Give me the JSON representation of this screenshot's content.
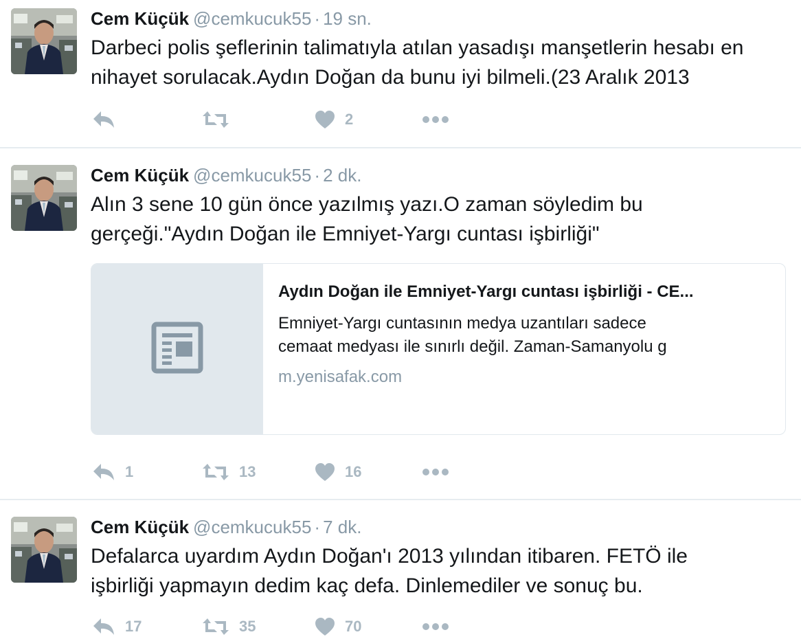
{
  "tweets": [
    {
      "name": "Cem Küçük",
      "handle": "@cemkucuk55",
      "separator": "·",
      "time": "19 sn.",
      "line1": "Darbeci polis şeflerinin talimatıyla atılan yasadışı manşetlerin hesabı en",
      "line2": "nihayet sorulacak.Aydın Doğan da bunu iyi bilmeli.(23 Aralık 2013",
      "reply_count": "",
      "retweet_count": "",
      "like_count": "2"
    },
    {
      "name": "Cem Küçük",
      "handle": "@cemkucuk55",
      "separator": "·",
      "time": "2 dk.",
      "line1": "Alın 3 sene 10 gün önce yazılmış yazı.O zaman söyledim bu",
      "line2": "gerçeği.\"Aydın Doğan ile Emniyet-Yargı cuntası işbirliği\"",
      "card": {
        "title": "Aydın Doğan ile Emniyet-Yargı cuntası işbirliği - CE...",
        "desc_line1": "Emniyet-Yargı cuntasının medya uzantıları sadece",
        "desc_line2": "cemaat medyası ile sınırlı değil. Zaman-Samanyolu g",
        "domain": "m.yenisafak.com",
        "icon": "article-icon"
      },
      "reply_count": "1",
      "retweet_count": "13",
      "like_count": "16"
    },
    {
      "name": "Cem Küçük",
      "handle": "@cemkucuk55",
      "separator": "·",
      "time": "7 dk.",
      "line1": "Defalarca uyardım Aydın Doğan'ı 2013 yılından itibaren. FETÖ ile",
      "line2": "işbirliği yapmayın dedim kaç defa. Dinlemediler ve sonuç bu.",
      "reply_count": "17",
      "retweet_count": "35",
      "like_count": "70"
    }
  ],
  "icons": {
    "reply": "reply-icon",
    "retweet": "retweet-icon",
    "like": "heart-icon",
    "more": "more-icon"
  },
  "colors": {
    "text": "#14171a",
    "muted": "#8899a6",
    "action": "#aab8c2",
    "separator": "#e6ecf0",
    "card_thumb": "#e1e8ed"
  }
}
